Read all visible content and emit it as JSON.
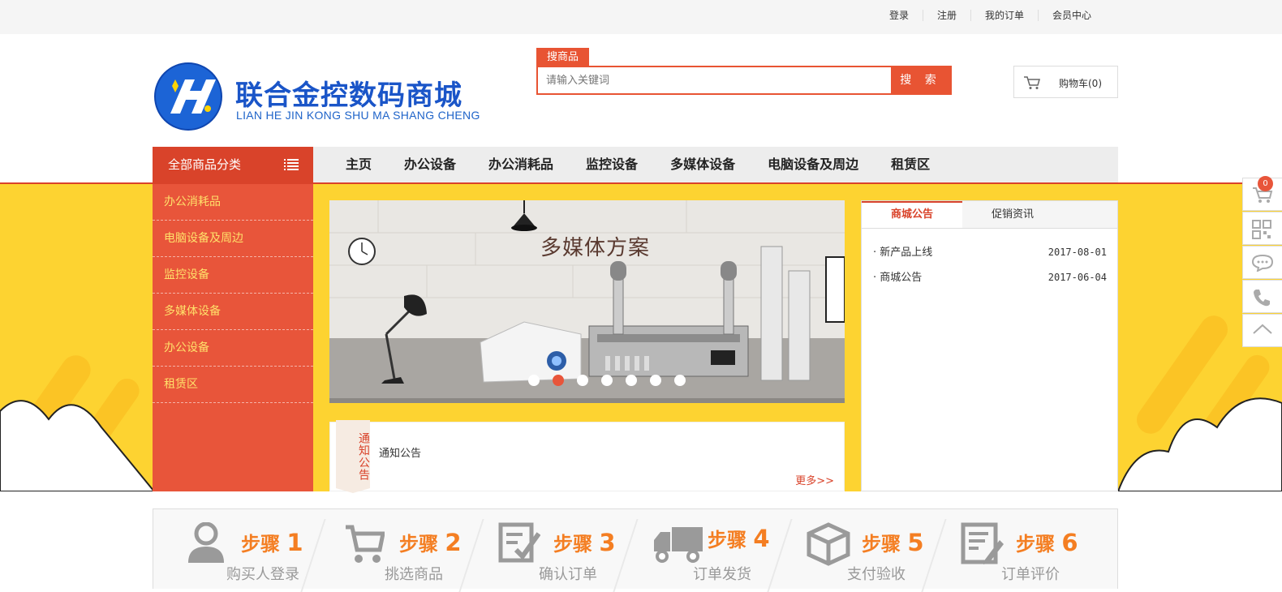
{
  "topbar": {
    "links": [
      "登录",
      "注册",
      "我的订单",
      "会员中心"
    ]
  },
  "logo": {
    "title": "联合金控数码商城",
    "subtitle": "LIAN HE JIN KONG SHU MA SHANG CHENG"
  },
  "search": {
    "tab_label": "搜商品",
    "placeholder": "请输入关键词",
    "button_label": "搜 索"
  },
  "cart": {
    "label": "购物车(0)"
  },
  "nav": {
    "all_categories": "全部商品分类",
    "items": [
      "主页",
      "办公设备",
      "办公消耗品",
      "监控设备",
      "多媒体设备",
      "电脑设备及周边",
      "租赁区"
    ]
  },
  "sidebar": {
    "categories": [
      "办公消耗品",
      "电脑设备及周边",
      "监控设备",
      "多媒体设备",
      "办公设备",
      "租赁区"
    ]
  },
  "banner": {
    "title": "多媒体方案",
    "dot_count": 7,
    "active_dot": 2
  },
  "notice": {
    "tag": "通知公告",
    "text": "通知公告",
    "more": "更多>>"
  },
  "announcements": {
    "tabs": [
      "商城公告",
      "促销资讯"
    ],
    "items": [
      {
        "title": "新产品上线",
        "date": "2017-08-01"
      },
      {
        "title": "商城公告",
        "date": "2017-06-04"
      }
    ]
  },
  "steps": [
    {
      "prefix": "步骤",
      "num": "1",
      "label": "购买人登录",
      "icon": "user-icon"
    },
    {
      "prefix": "步骤",
      "num": "2",
      "label": "挑选商品",
      "icon": "cart-icon"
    },
    {
      "prefix": "步骤",
      "num": "3",
      "label": "确认订单",
      "icon": "checklist-icon"
    },
    {
      "prefix": "步骤",
      "num": "4",
      "label": "订单发货",
      "icon": "truck-icon"
    },
    {
      "prefix": "步骤",
      "num": "5",
      "label": "支付验收",
      "icon": "box-icon"
    },
    {
      "prefix": "步骤",
      "num": "6",
      "label": "订单评价",
      "icon": "review-icon"
    }
  ],
  "right_tools": {
    "cart_badge": "0"
  },
  "colors": {
    "accent": "#e85433",
    "yellow": "#fdd331",
    "logo_blue": "#1a55c8",
    "step_orange": "#f47e22"
  }
}
